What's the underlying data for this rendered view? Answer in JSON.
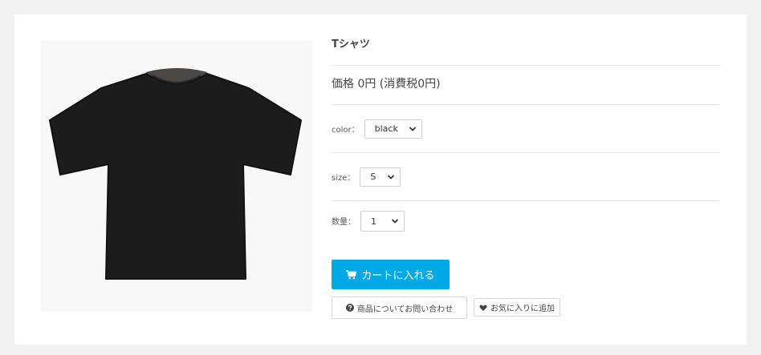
{
  "product": {
    "title": "Tシャツ",
    "price_text": "価格 0円 (消費税0円)"
  },
  "options": {
    "color": {
      "label": "color：",
      "selected": "black"
    },
    "size": {
      "label": "size：",
      "selected": "S"
    },
    "quantity": {
      "label": "数量：",
      "selected": "1"
    }
  },
  "actions": {
    "add_to_cart": "カートに入れる",
    "inquiry": "商品についてお問い合わせ",
    "favorite": "お気に入りに追加"
  },
  "colors": {
    "accent": "#00a8e6",
    "shirt": "#1c1c1c",
    "collar": "#4a4744"
  },
  "icons": {
    "cart": "cart-icon",
    "question": "question-circle-icon",
    "heart": "heart-icon",
    "chevron": "chevron-down-icon"
  }
}
